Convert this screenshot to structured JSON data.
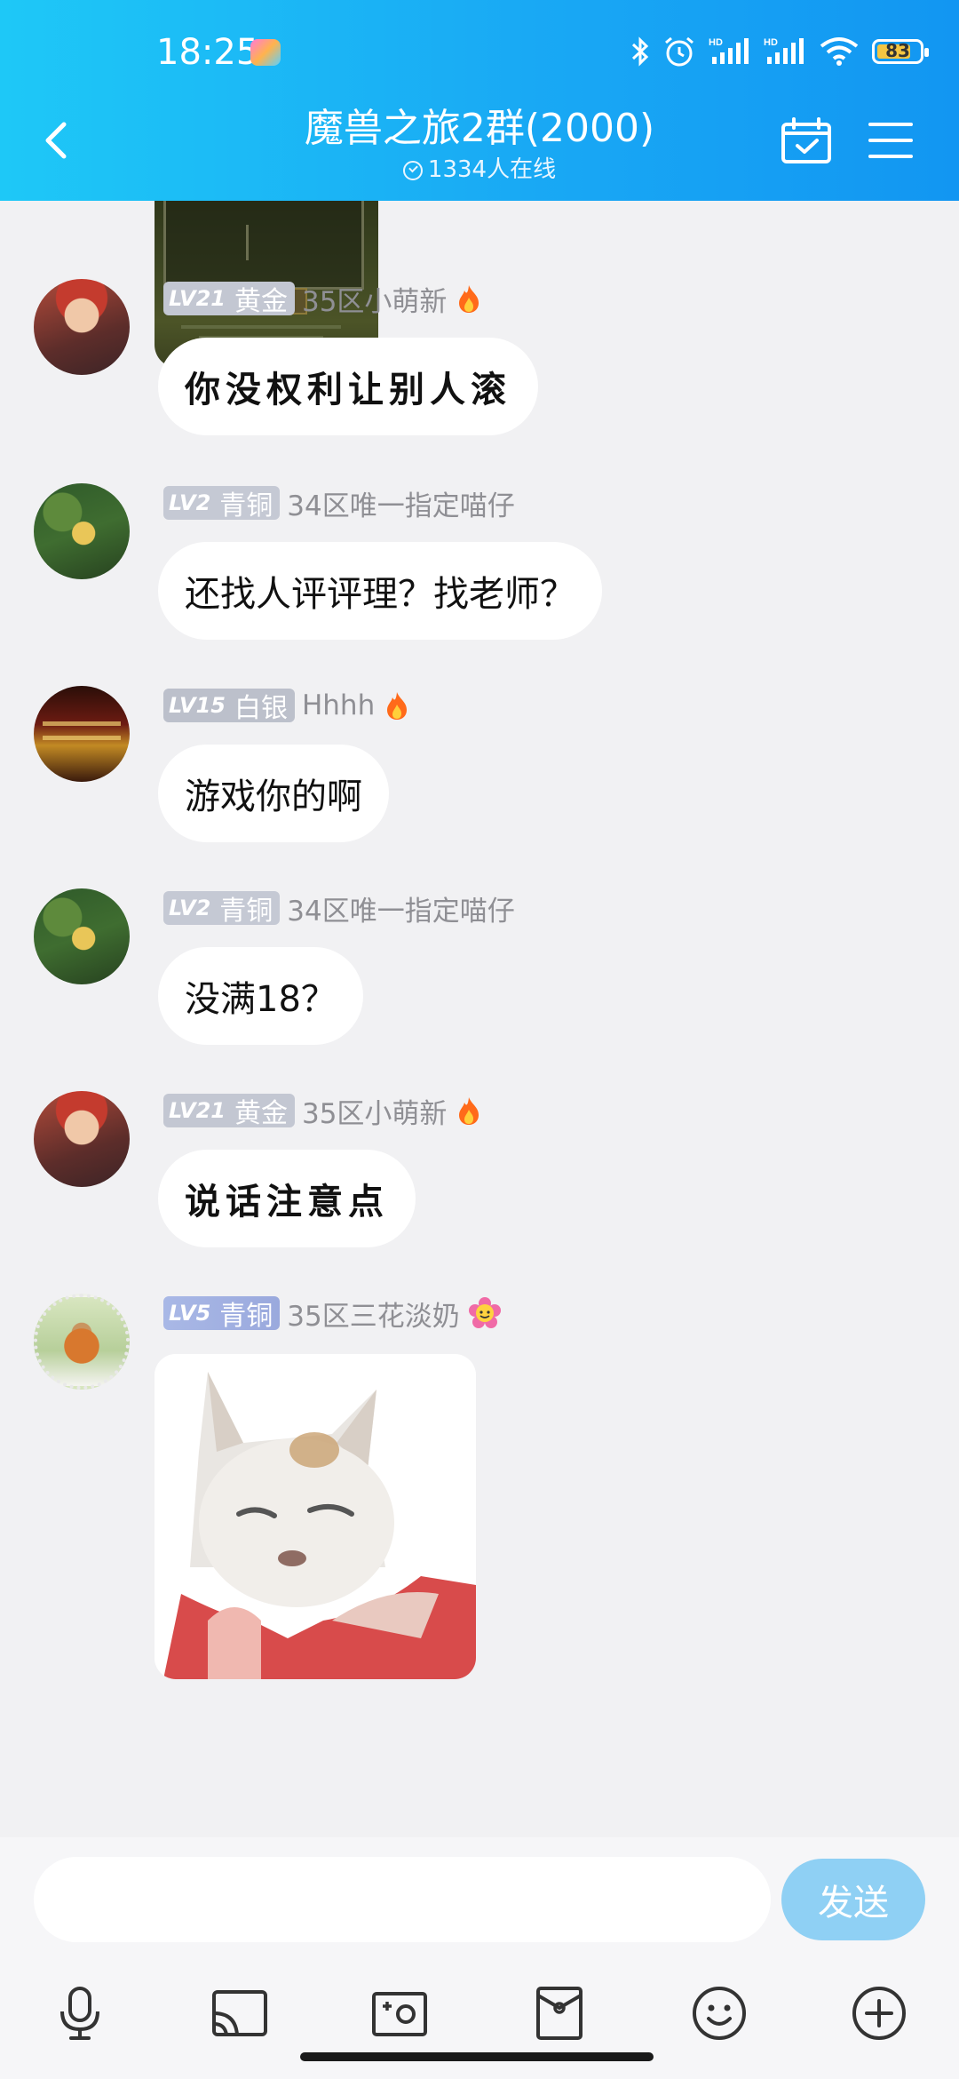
{
  "status_bar": {
    "time": "18:25",
    "battery": "83",
    "battery_level": 0.83,
    "icons": [
      "bluetooth-icon",
      "alarm-icon",
      "hd-signal-icon",
      "hd-signal-icon",
      "wifi-icon",
      "battery-icon"
    ]
  },
  "header": {
    "title": "魔兽之旅2群(2000)",
    "online": "1334人在线"
  },
  "messages": [
    {
      "level": "LV21",
      "rank": "黄金",
      "name": "35区小萌新",
      "text": "你没权利让别人滚",
      "style": "script"
    },
    {
      "level": "LV2",
      "rank": "青铜",
      "name": "34区唯一指定喵仔",
      "text": "还找人评评理？找老师？"
    },
    {
      "level": "LV15",
      "rank": "白银",
      "name": "Hhhh",
      "text": "游戏你的啊"
    },
    {
      "level": "LV2",
      "rank": "青铜",
      "name": "34区唯一指定喵仔",
      "text": "没满18？"
    },
    {
      "level": "LV21",
      "rank": "黄金",
      "name": "35区小萌新",
      "text": "说话注意点",
      "style": "script"
    },
    {
      "level": "LV5",
      "rank": "青铜",
      "name": "35区三花淡奶",
      "sticker": "cat-sticker"
    }
  ],
  "input": {
    "placeholder": "",
    "send_label": "发送"
  },
  "toolbar": [
    "microphone-icon",
    "screen-cast-icon",
    "camera-icon",
    "red-packet-icon",
    "emoji-icon",
    "plus-icon"
  ],
  "colors": {
    "header_start": "#1ec8f7",
    "header_end": "#1296f2",
    "background": "#f1f1f3",
    "send_button": "#8fd0f4"
  }
}
